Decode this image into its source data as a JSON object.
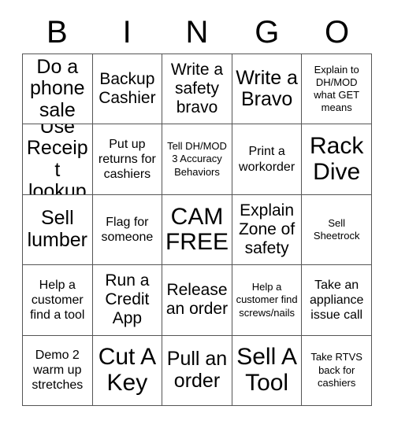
{
  "card": {
    "header_letters": [
      "B",
      "I",
      "N",
      "G",
      "O"
    ],
    "rows": [
      [
        {
          "text": "Do a phone sale",
          "size": "lg"
        },
        {
          "text": "Backup Cashier",
          "size": "md"
        },
        {
          "text": "Write a safety bravo",
          "size": "md"
        },
        {
          "text": "Write a Bravo",
          "size": "lg"
        },
        {
          "text": "Explain to DH/MOD what GET means",
          "size": "xs"
        }
      ],
      [
        {
          "text": "Use Receipt lookup",
          "size": "lg"
        },
        {
          "text": "Put up returns for cashiers",
          "size": "sm"
        },
        {
          "text": "Tell DH/MOD 3 Accuracy Behaviors",
          "size": "xs"
        },
        {
          "text": "Print a workorder",
          "size": "sm"
        },
        {
          "text": "Rack Dive",
          "size": "xl"
        }
      ],
      [
        {
          "text": "Sell lumber",
          "size": "lg"
        },
        {
          "text": "Flag for someone",
          "size": "sm"
        },
        {
          "text": "CAM FREE",
          "size": "xl"
        },
        {
          "text": "Explain Zone of safety",
          "size": "md"
        },
        {
          "text": "Sell Sheetrock",
          "size": "xs"
        }
      ],
      [
        {
          "text": "Help a customer find a tool",
          "size": "sm"
        },
        {
          "text": "Run a Credit App",
          "size": "md"
        },
        {
          "text": "Release an order",
          "size": "md"
        },
        {
          "text": "Help a customer find screws/nails",
          "size": "xs"
        },
        {
          "text": "Take an appliance issue call",
          "size": "sm"
        }
      ],
      [
        {
          "text": "Demo 2 warm up stretches",
          "size": "sm"
        },
        {
          "text": "Cut A Key",
          "size": "xl"
        },
        {
          "text": "Pull an order",
          "size": "lg"
        },
        {
          "text": "Sell A Tool",
          "size": "xl"
        },
        {
          "text": "Take RTVS back for cashiers",
          "size": "xs"
        }
      ]
    ]
  }
}
